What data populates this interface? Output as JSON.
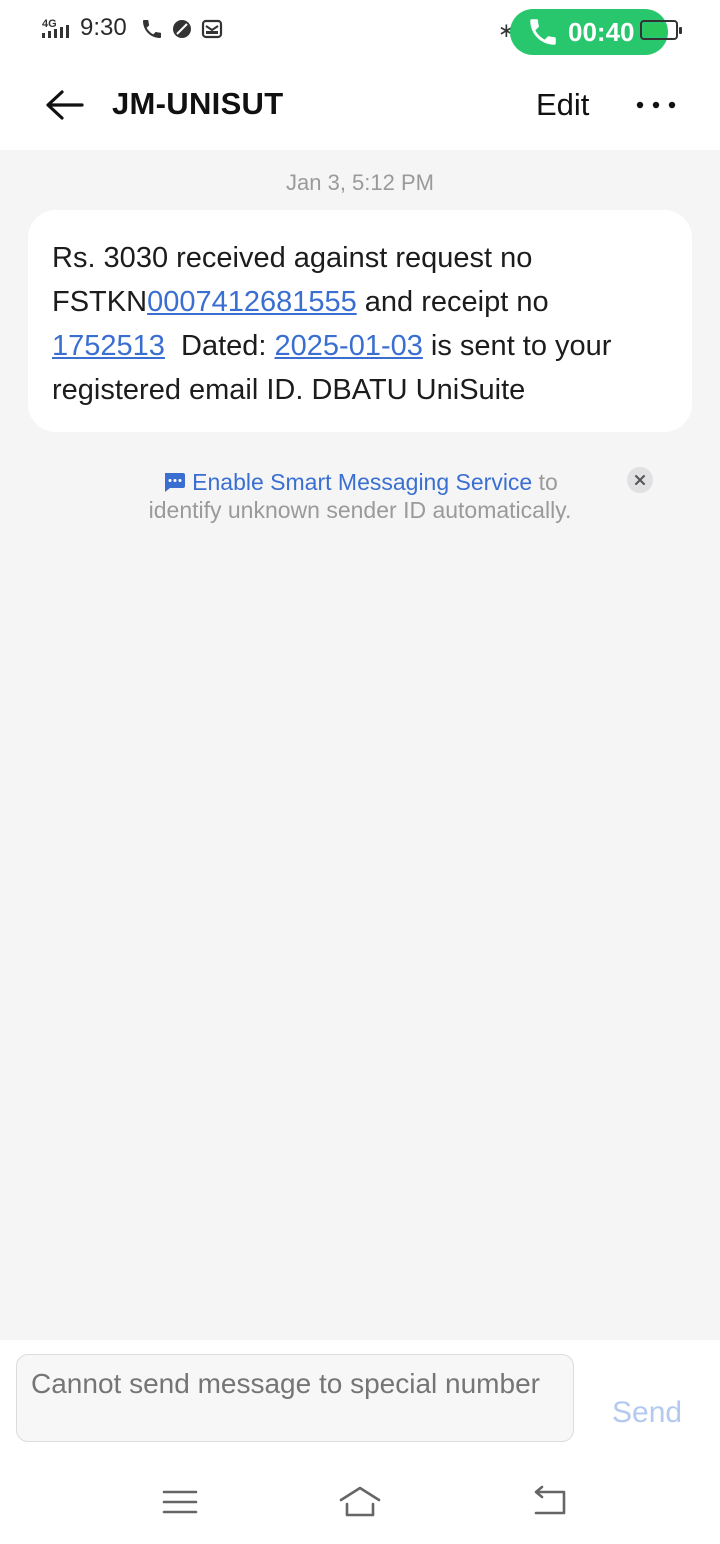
{
  "status_bar": {
    "network": "4G",
    "time": "9:30",
    "call_timer": "00:40",
    "battery_color": "#2ac85b",
    "call_pill_color": "#29c76d",
    "icons": [
      "signal-icon",
      "phone-icon",
      "leaf-icon",
      "mail-icon",
      "bluetooth-icon",
      "call-icon",
      "battery-icon"
    ]
  },
  "header": {
    "title": "JM-UNISUT",
    "edit_label": "Edit",
    "icons": [
      "back-arrow-icon",
      "more-icon"
    ]
  },
  "conversation": {
    "timestamp": "Jan 3, 5:12 PM",
    "message": {
      "part1": "Rs. 3030 received against request no",
      "part2": "FSTKN",
      "link1": "0007412681555",
      "part3": " and receipt no",
      "link2": "1752513",
      "part4": "  Dated: ",
      "link3": "2025-01-03",
      "part5": " is sent to your",
      "part6": "registered email ID. DBATU UniSuite"
    },
    "smart_messaging": {
      "link_text": "Enable Smart Messaging Service",
      "text_after": " to",
      "text_line2": "identify unknown sender ID automatically.",
      "icons": [
        "chat-bubble-icon",
        "close-icon"
      ]
    },
    "link_color": "#3a6fd1"
  },
  "composer": {
    "placeholder": "Cannot send message to special number",
    "send_label": "Send"
  },
  "navbar": {
    "icons": [
      "menu-icon",
      "home-icon",
      "back-icon"
    ]
  }
}
